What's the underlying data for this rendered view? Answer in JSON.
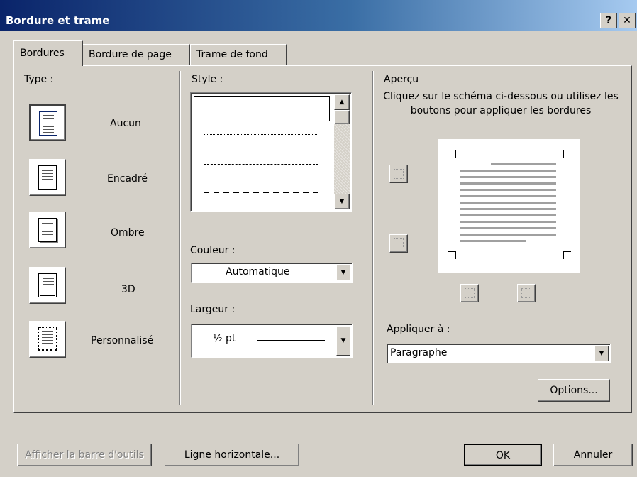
{
  "window": {
    "title": "Bordure et trame",
    "help_btn": "?",
    "close_btn": "✕"
  },
  "tabs": [
    {
      "label": "Bordures",
      "active": true
    },
    {
      "label": "Bordure de page",
      "active": false
    },
    {
      "label": "Trame de fond",
      "active": false
    }
  ],
  "type_section": {
    "label": "Type :",
    "items": [
      {
        "label": "Aucun",
        "icon": "no-border-icon"
      },
      {
        "label": "Encadré",
        "icon": "box-border-icon"
      },
      {
        "label": "Ombre",
        "icon": "shadow-border-icon"
      },
      {
        "label": "3D",
        "icon": "3d-border-icon"
      },
      {
        "label": "Personnalisé",
        "icon": "custom-border-icon"
      }
    ]
  },
  "style_section": {
    "label": "Style :",
    "color_label": "Couleur :",
    "color_value": "Automatique",
    "width_label": "Largeur :",
    "width_value": "½ pt"
  },
  "preview_section": {
    "label": "Aperçu",
    "instructions": "Cliquez sur le schéma ci-dessous ou utilisez les boutons pour appliquer les bordures",
    "apply_label": "Appliquer à :",
    "apply_value": "Paragraphe",
    "options_button": "Options..."
  },
  "footer": {
    "toolbar_button": "Afficher la barre d'outils",
    "horizontal_line_button": "Ligne horizontale...",
    "ok_button": "OK",
    "cancel_button": "Annuler"
  }
}
